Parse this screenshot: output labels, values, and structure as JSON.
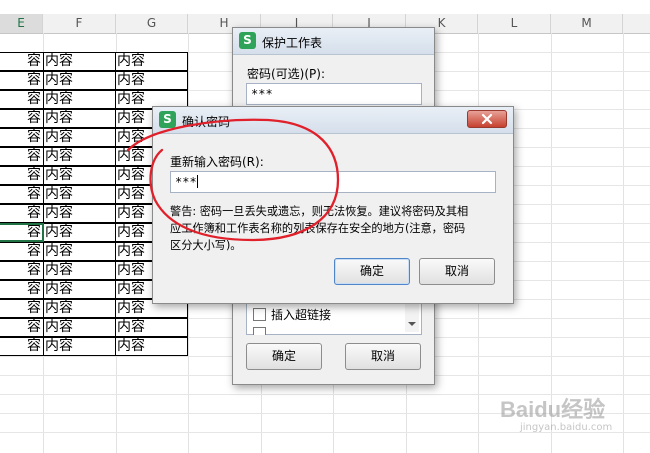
{
  "sheet": {
    "columns": [
      "E",
      "F",
      "G",
      "H",
      "I",
      "J",
      "K",
      "L",
      "M"
    ],
    "rows": [
      [
        "容",
        "内容",
        "内容"
      ],
      [
        "容",
        "内容",
        "内容"
      ],
      [
        "容",
        "内容",
        "内容"
      ],
      [
        "容",
        "内容",
        "内容"
      ],
      [
        "容",
        "内容",
        "内容"
      ],
      [
        "容",
        "内容",
        "内容"
      ],
      [
        "容",
        "内容",
        "内容"
      ],
      [
        "容",
        "内容",
        "内容"
      ],
      [
        "容",
        "内容",
        "内容"
      ],
      [
        "容",
        "内容",
        "内容"
      ],
      [
        "容",
        "内容",
        "内容"
      ],
      [
        "容",
        "内容",
        "内容"
      ],
      [
        "容",
        "内容",
        "内容"
      ],
      [
        "容",
        "内容",
        "内容"
      ],
      [
        "容",
        "内容",
        "内容"
      ],
      [
        "容",
        "内容",
        "内容"
      ]
    ]
  },
  "protect_dialog": {
    "logo": "S",
    "title": "保护工作表",
    "password_label": "密码(可选)(P):",
    "password_value": "***",
    "permission_item": "插入超链接",
    "ok_label": "确定",
    "cancel_label": "取消"
  },
  "confirm_dialog": {
    "logo": "S",
    "title": "确认密码",
    "close_icon": "close-icon",
    "reenter_label": "重新输入密码(R):",
    "reenter_value": "***",
    "warning_line1": "警告: 密码一旦丢失或遗忘，则无法恢复。建议将密码及其相",
    "warning_line2": "应工作簿和工作表名称的列表保存在安全的地方(注意，密码",
    "warning_line3": "区分大小写)。",
    "ok_label": "确定",
    "cancel_label": "取消"
  },
  "colors": {
    "annotation": "#e0202a",
    "close_button": "#d9443a",
    "active_cell_border": "#217346",
    "wps_logo": "#2fa35a"
  },
  "watermark": {
    "brand": "Baidu经验",
    "url": "jingyan.baidu.com"
  }
}
